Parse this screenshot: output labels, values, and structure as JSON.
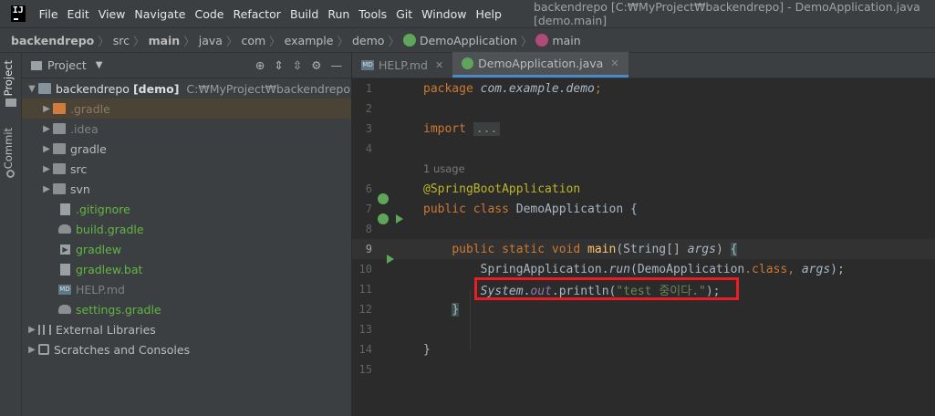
{
  "menubar": {
    "items": [
      "File",
      "Edit",
      "View",
      "Navigate",
      "Code",
      "Refactor",
      "Build",
      "Run",
      "Tools",
      "Git",
      "Window",
      "Help"
    ],
    "window_title": "backendrepo [C:₩MyProject₩backendrepo] - DemoApplication.java [demo.main]"
  },
  "breadcrumb": {
    "items": [
      "backendrepo",
      "src",
      "main",
      "java",
      "com",
      "example",
      "demo",
      "DemoApplication",
      "main"
    ]
  },
  "side_strip": {
    "project": "Project",
    "commit": "Commit"
  },
  "project_panel": {
    "title": "Project",
    "root": {
      "name": "backendrepo",
      "module": "[demo]",
      "path": "C:₩MyProject₩backendrepo"
    },
    "items": [
      ".gradle",
      ".idea",
      "gradle",
      "src",
      "svn",
      ".gitignore",
      "build.gradle",
      "gradlew",
      "gradlew.bat",
      "HELP.md",
      "settings.gradle"
    ],
    "external": "External Libraries",
    "scratches": "Scratches and Consoles"
  },
  "editor": {
    "tabs": [
      "HELP.md",
      "DemoApplication.java"
    ],
    "line_numbers": [
      "1",
      "2",
      "3",
      "4",
      "6",
      "7",
      "8",
      "9",
      "10",
      "11",
      "12",
      "13",
      "14",
      "15"
    ],
    "code": {
      "l1_kw": "package",
      "l1_pkg": "com.example.demo",
      "l1_end": ";",
      "l3_kw": "import",
      "l3_fold": "...",
      "usage": "1 usage",
      "l6_ann": "@SpringBootApplication",
      "l7_kw": "public class",
      "l7_cls": "DemoApplication",
      "l7_end": "{",
      "l9_kw": "public static void",
      "l9_name": "main",
      "l9_params_open": "(",
      "l9_type": "String[]",
      "l9_arg": "args",
      "l9_close": ")",
      "l9_brace": "{",
      "l10_cls": "SpringApplication",
      "l10_dot": ".",
      "l10_method": "run",
      "l10_open": "(",
      "l10_arg1": "DemoApplication",
      "l10_mid": ".class, ",
      "l10_arg2": "args",
      "l10_end": ");",
      "l11_cls": "System",
      "l11_dot": ".",
      "l11_field": "out",
      "l11_rest": ".println(",
      "l11_str": "\"test 중이다.\"",
      "l11_end": ");",
      "l12_brace": "}",
      "l14_brace": "}"
    }
  },
  "colors": {
    "highlight_box": "#e81e24",
    "accent": "#4a88c7"
  }
}
